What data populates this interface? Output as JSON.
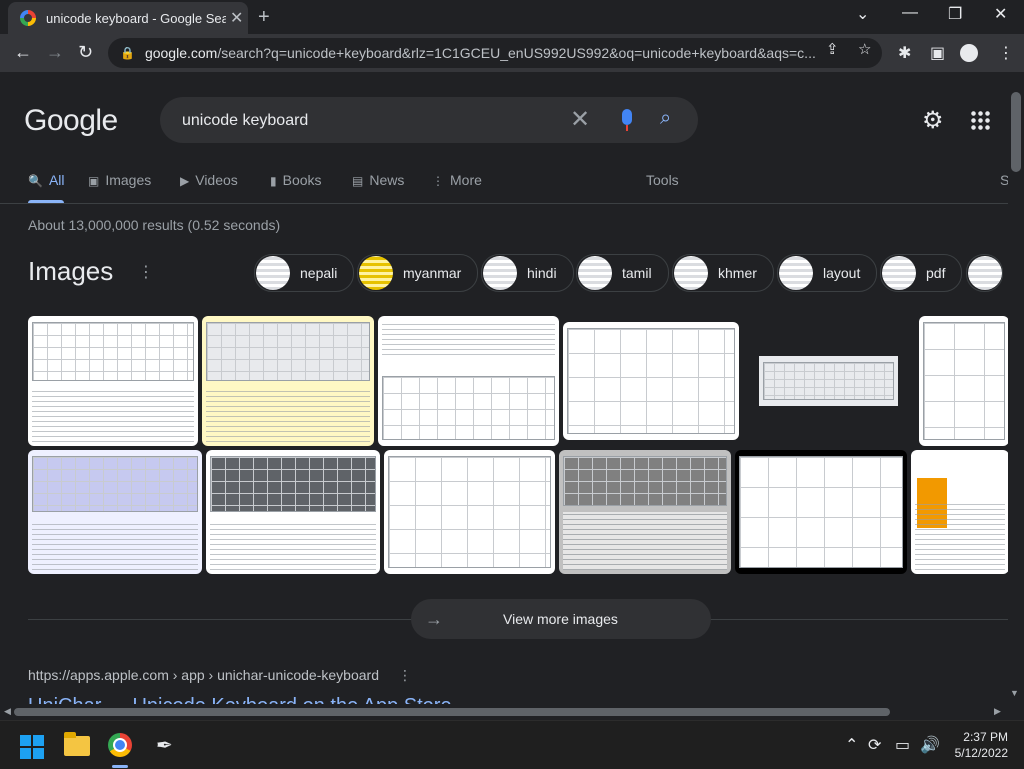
{
  "browser": {
    "tab_title": "unicode keyboard - Google Search",
    "tab_close": "✕",
    "new_tab": "+",
    "window_controls": [
      "⌄",
      "—",
      "❐",
      "✕"
    ],
    "nav": {
      "back": "←",
      "forward": "→",
      "reload": "↻"
    },
    "url_host": "google.com",
    "url_rest": "/search?q=unicode+keyboard&rlz=1C1GCEU_enUS992US992&oq=unicode+keyboard&aqs=c...",
    "icons": [
      "lock-icon",
      "share-icon",
      "star-icon",
      "extensions-icon",
      "sidepanel-icon",
      "profile-icon",
      "menu-icon"
    ]
  },
  "google": {
    "logo": "Google",
    "query": "unicode keyboard",
    "clear": "✕",
    "tabs": [
      {
        "label": "All",
        "icon": "🔍"
      },
      {
        "label": "Images",
        "icon": "▣"
      },
      {
        "label": "Videos",
        "icon": "▶"
      },
      {
        "label": "Books",
        "icon": "▮"
      },
      {
        "label": "News",
        "icon": "▤"
      },
      {
        "label": "More",
        "icon": "⋮"
      }
    ],
    "tools": "Tools",
    "safe": "S",
    "stats": "About 13,000,000 results (0.52 seconds)",
    "images_heading": "Images",
    "chips": [
      "nepali",
      "myanmar",
      "hindi",
      "tamil",
      "khmer",
      "layout",
      "pdf"
    ],
    "view_more": "View more images",
    "result": {
      "breadcrumb": "https://apps.apple.com › app › unichar-unicode-keyboard",
      "title": "UniChar — Unicode Keyboard on the App Store"
    }
  },
  "taskbar": {
    "time": "2:37 PM",
    "date": "5/12/2022",
    "tray_icons": [
      "chevron-up-icon",
      "sync-icon",
      "display-icon",
      "volume-icon"
    ]
  },
  "colors": {
    "background": "#202124",
    "link": "#8ab4f8",
    "surface": "#303134"
  }
}
